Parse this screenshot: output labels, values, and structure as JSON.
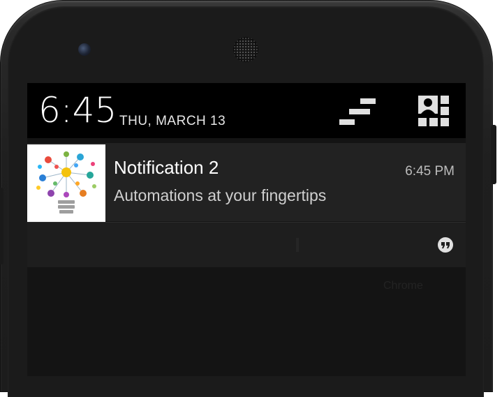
{
  "status_bar": {
    "time": "6:45",
    "date": "THU, MARCH 13",
    "settings_icon": "quick-settings-icon",
    "user_icon": "user-profile-icon"
  },
  "notifications": [
    {
      "title": "Notification 2",
      "text": "Automations at your fingertips",
      "time": "6:45 PM",
      "icon": "lightbulb-network-icon"
    },
    {
      "icon": "hangouts-icon"
    }
  ],
  "background_hint": "Chrome",
  "colors": {
    "status_bar_bg": "#000000",
    "notification_bg": "#222222",
    "screen_bg": "#141414"
  }
}
